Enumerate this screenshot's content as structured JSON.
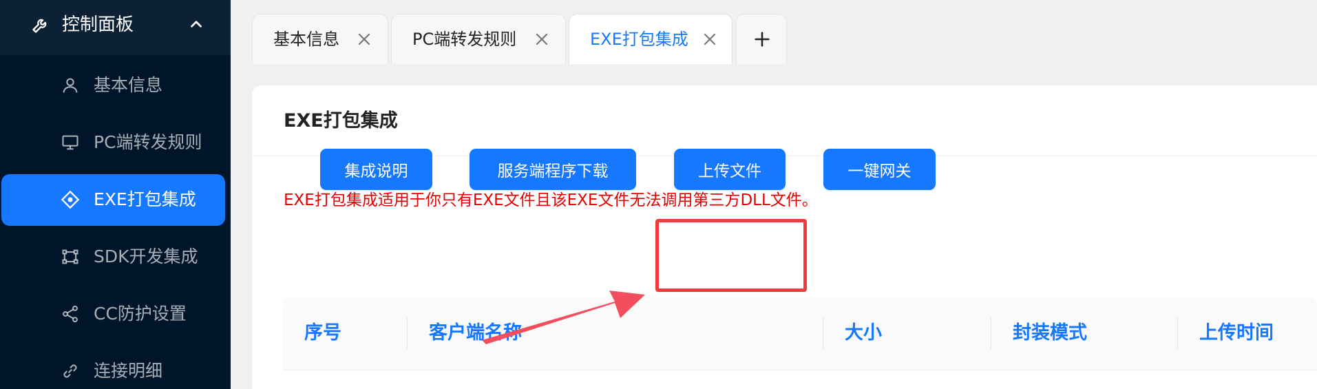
{
  "sidebar": {
    "header": {
      "label": "控制面板",
      "icon": "wrench-icon",
      "chevron": "chevron-up-icon"
    },
    "items": [
      {
        "label": "基本信息",
        "icon": "user-icon"
      },
      {
        "label": "PC端转发规则",
        "icon": "monitor-icon"
      },
      {
        "label": "EXE打包集成",
        "icon": "diamond-icon",
        "active": true
      },
      {
        "label": "SDK开发集成",
        "icon": "frame-icon"
      },
      {
        "label": "CC防护设置",
        "icon": "share-icon"
      },
      {
        "label": "连接明细",
        "icon": "link-icon"
      }
    ]
  },
  "tabs": [
    {
      "label": "基本信息"
    },
    {
      "label": "PC端转发规则"
    },
    {
      "label": "EXE打包集成",
      "active": true
    }
  ],
  "add_tab_icon": "plus-icon",
  "main": {
    "title": "EXE打包集成",
    "notice": "EXE打包集成适用于你只有EXE文件且该EXE文件无法调用第三方DLL文件。",
    "buttons": {
      "guide": "集成说明",
      "download": "服务端程序下载",
      "upload": "上传文件",
      "gateway": "一键网关"
    },
    "table": {
      "columns": [
        "序号",
        "客户端名称",
        "大小",
        "封装模式",
        "上传时间"
      ]
    }
  },
  "colors": {
    "primary": "#1677ff",
    "sidebar_bg": "#001529",
    "notice": "#e60000",
    "annotation": "#ef3b3b"
  }
}
